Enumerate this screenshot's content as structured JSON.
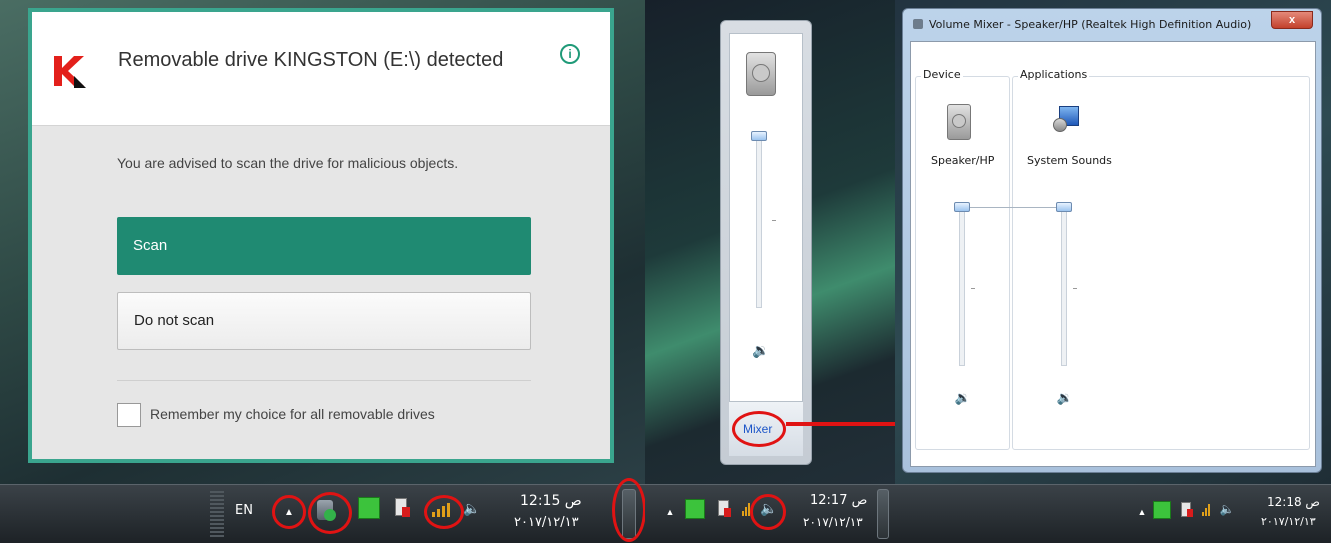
{
  "kaspersky": {
    "title": "Removable drive KINGSTON (E:\\) detected",
    "message": "You are advised to scan the drive for malicious objects.",
    "scan_label": "Scan",
    "noscan_label": "Do not scan",
    "remember_label": "Remember my choice for all removable drives",
    "remember_checked": false,
    "accent": "#1f8a72",
    "border": "#3aa58e"
  },
  "taskbar1": {
    "lang": "EN",
    "time": "12:15 ص",
    "date": "٢٠١٧/١٢/١٣"
  },
  "volume_popup": {
    "mixer_label": "Mixer",
    "level": 1.0
  },
  "taskbar2": {
    "time": "12:17 ص",
    "date": "٢٠١٧/١٢/١٣"
  },
  "mixer": {
    "title": "Volume Mixer - Speaker/HP (Realtek High Definition Audio)",
    "close": "x",
    "device_group": "Device",
    "apps_group": "Applications",
    "device_name": "Speaker/HP",
    "app_name": "System Sounds",
    "device_level": 1.0,
    "app_level": 1.0
  },
  "taskbar3": {
    "time": "12:18 ص",
    "date": "٢٠١٧/١٢/١٣"
  },
  "icons": [
    "kaspersky-logo-icon",
    "info-icon",
    "speaker-device-icon",
    "system-sounds-icon",
    "volume-icon",
    "show-hidden-icons-icon",
    "network-icon",
    "power-icon",
    "flag-icon",
    "usb-icon"
  ],
  "annotation_color": "#e01313"
}
